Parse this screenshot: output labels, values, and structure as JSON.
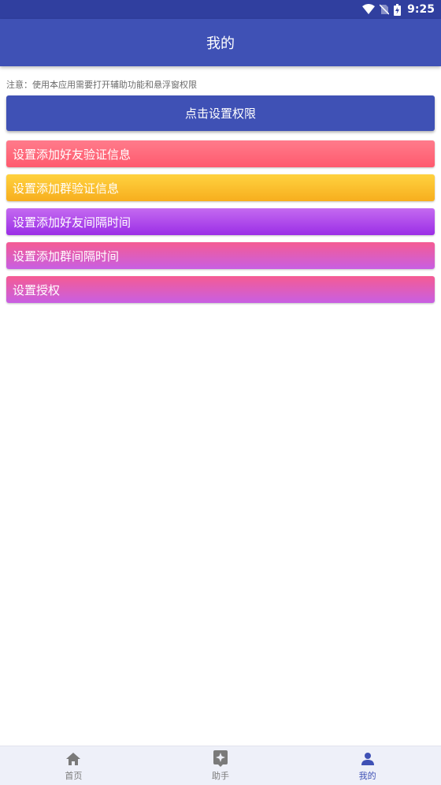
{
  "status_bar": {
    "time": "9:25",
    "icons": [
      "wifi-icon",
      "no-sim-icon",
      "battery-charging-icon"
    ]
  },
  "app_bar": {
    "title": "我的"
  },
  "notice": {
    "text": "注意：使用本应用需要打开辅助功能和悬浮窗权限"
  },
  "permission_button": {
    "label": "点击设置权限",
    "color": "#3f51b5"
  },
  "menu": {
    "items": [
      {
        "label": "设置添加好友验证信息"
      },
      {
        "label": "设置添加群验证信息"
      },
      {
        "label": "设置添加好友间隔时间"
      },
      {
        "label": "设置添加群间隔时间"
      },
      {
        "label": "设置授权"
      }
    ]
  },
  "bottom_nav": {
    "items": [
      {
        "label": "首页",
        "icon": "home-icon",
        "active": false
      },
      {
        "label": "助手",
        "icon": "assistant-icon",
        "active": false
      },
      {
        "label": "我的",
        "icon": "person-icon",
        "active": true
      }
    ],
    "active_color": "#3f51b5"
  }
}
